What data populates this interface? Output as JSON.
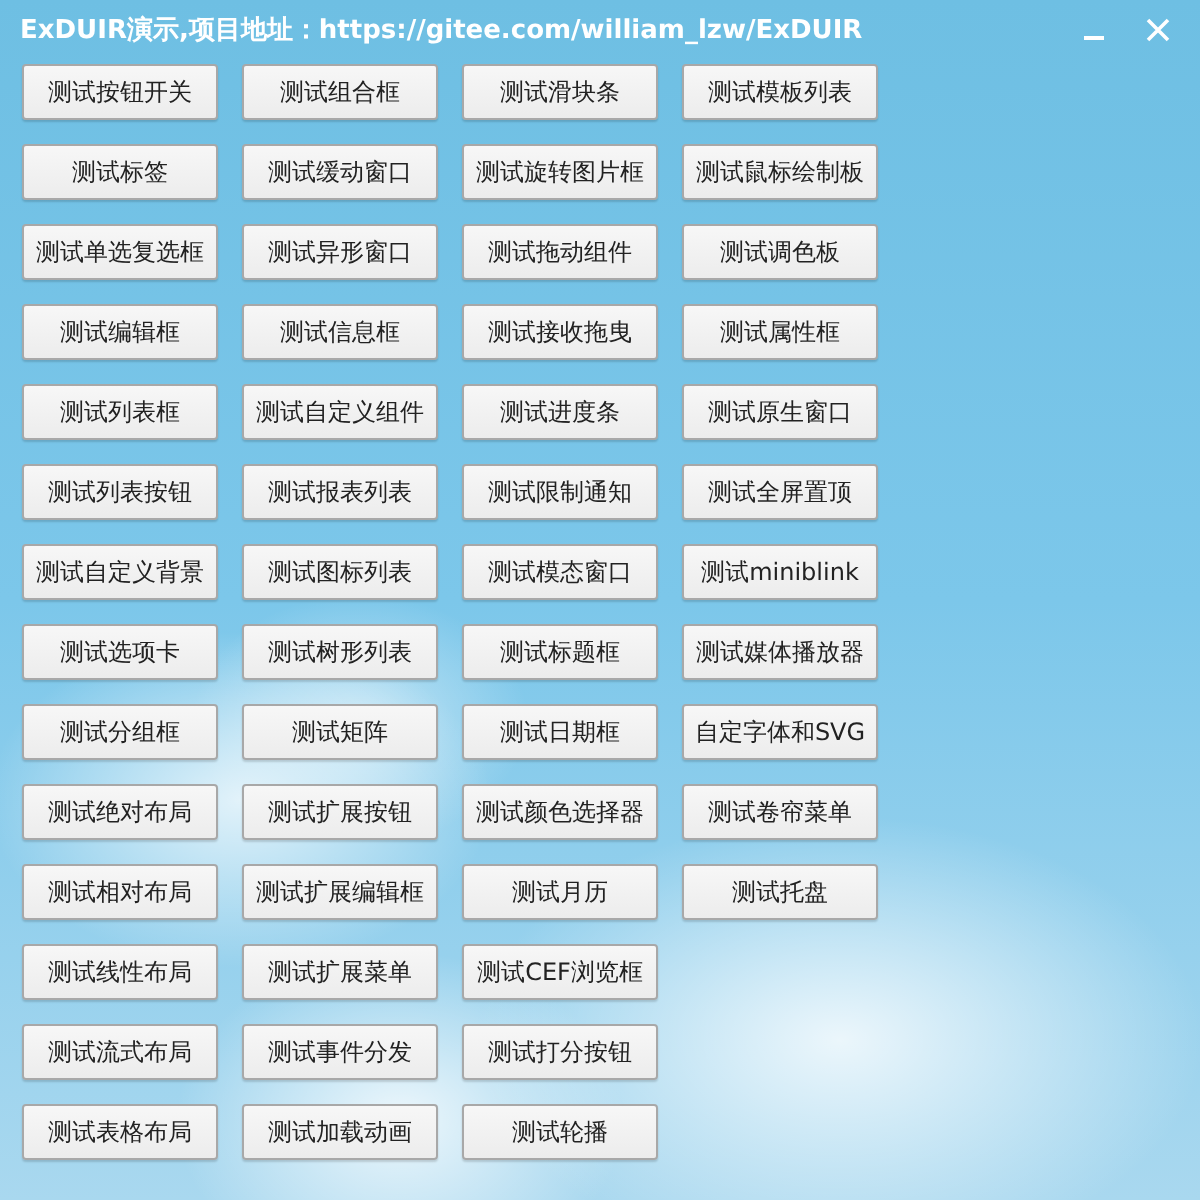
{
  "window": {
    "title": "ExDUIR演示,项目地址：https://gitee.com/william_lzw/ExDUIR"
  },
  "button_rows": [
    [
      "测试按钮开关",
      "测试组合框",
      "测试滑块条",
      "测试模板列表"
    ],
    [
      "测试标签",
      "测试缓动窗口",
      "测试旋转图片框",
      "测试鼠标绘制板"
    ],
    [
      "测试单选复选框",
      "测试异形窗口",
      "测试拖动组件",
      "测试调色板"
    ],
    [
      "测试编辑框",
      "测试信息框",
      "测试接收拖曳",
      "测试属性框"
    ],
    [
      "测试列表框",
      "测试自定义组件",
      "测试进度条",
      "测试原生窗口"
    ],
    [
      "测试列表按钮",
      "测试报表列表",
      "测试限制通知",
      "测试全屏置顶"
    ],
    [
      "测试自定义背景",
      "测试图标列表",
      "测试模态窗口",
      "测试miniblink"
    ],
    [
      "测试选项卡",
      "测试树形列表",
      "测试标题框",
      "测试媒体播放器"
    ],
    [
      "测试分组框",
      "测试矩阵",
      "测试日期框",
      "自定字体和SVG"
    ],
    [
      "测试绝对布局",
      "测试扩展按钮",
      "测试颜色选择器",
      "测试卷帘菜单"
    ],
    [
      "测试相对布局",
      "测试扩展编辑框",
      "测试月历",
      "测试托盘"
    ],
    [
      "测试线性布局",
      "测试扩展菜单",
      "测试CEF浏览框"
    ],
    [
      "测试流式布局",
      "测试事件分发",
      "测试打分按钮"
    ],
    [
      "测试表格布局",
      "测试加载动画",
      "测试轮播"
    ]
  ]
}
